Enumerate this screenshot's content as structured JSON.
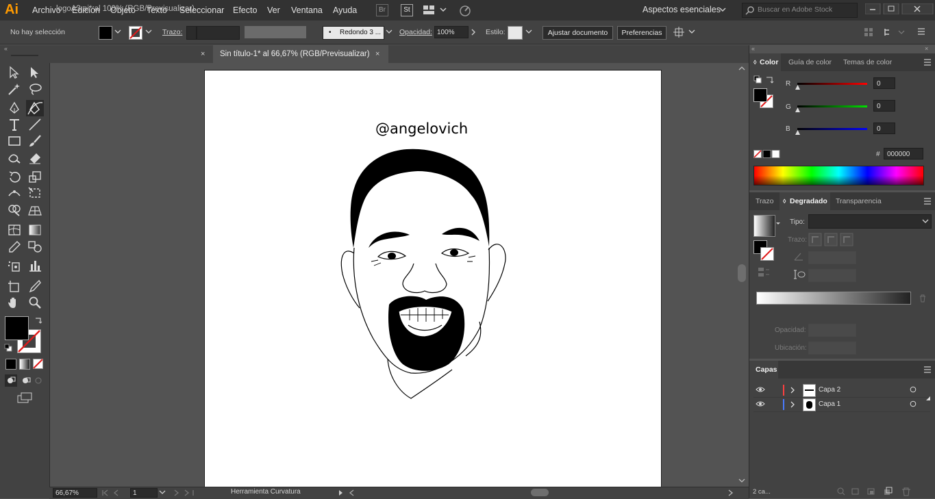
{
  "app": {
    "logo": "Ai"
  },
  "menu": [
    "Archivo",
    "Edición",
    "Objeto",
    "Texto",
    "Seleccionar",
    "Efecto",
    "Ver",
    "Ventana",
    "Ayuda"
  ],
  "menubar_icons": {
    "bridge": "Br",
    "stock": "St"
  },
  "workspace": "Aspectos esenciales",
  "search": {
    "placeholder": "Buscar en Adobe Stock"
  },
  "control": {
    "selection": "No hay selección",
    "stroke_label": "Trazo:",
    "brush": "Redondo 3 ...",
    "opacity_label": "Opacidad:",
    "opacity_value": "100%",
    "style_label": "Estilo:",
    "fit_button": "Ajustar documento",
    "prefs_button": "Preferencias"
  },
  "tabs": [
    {
      "label": "logoA3.ai* al 100% (RGB/Previsualizar)",
      "close": "×"
    },
    {
      "label": "Sin título-1* al 66,67% (RGB/Previsualizar)",
      "close": "×"
    }
  ],
  "canvas": {
    "handle": "@angelovich"
  },
  "color_panel": {
    "tabs": [
      "Color",
      "Guía de color",
      "Temas de color"
    ],
    "r_label": "R",
    "g_label": "G",
    "b_label": "B",
    "r": "0",
    "g": "0",
    "b": "0",
    "hash": "#",
    "hex": "000000"
  },
  "gradient_panel": {
    "tabs": [
      "Trazo",
      "Degradado",
      "Transparencia"
    ],
    "type_label": "Tipo:",
    "stroke_label": "Trazo:",
    "opacity_label": "Opacidad:",
    "location_label": "Ubicación:"
  },
  "layers_panel": {
    "title": "Capas",
    "layers": [
      {
        "name": "Capa 2",
        "color": "#ff4040"
      },
      {
        "name": "Capa 1",
        "color": "#4a7bff"
      }
    ],
    "count": "2 ca..."
  },
  "status": {
    "zoom": "66,67%",
    "page": "1",
    "tool": "Herramienta Curvatura"
  },
  "colors": {
    "accent": "#ff9a00",
    "bg": "#535353",
    "panel": "#424242"
  }
}
